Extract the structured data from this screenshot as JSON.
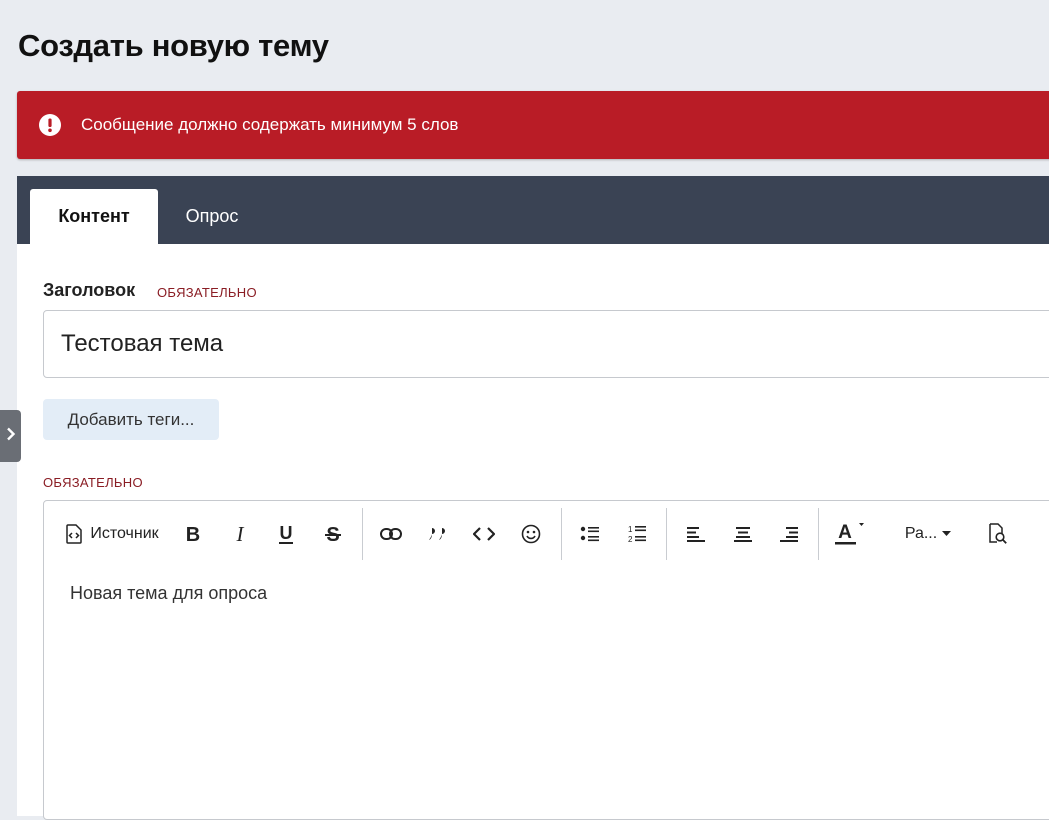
{
  "page": {
    "title": "Создать новую тему"
  },
  "alert": {
    "message": "Сообщение должно содержать минимум 5 слов",
    "icon": "exclamation-circle-icon",
    "color": "#b91c26"
  },
  "tabs": [
    {
      "label": "Контент",
      "active": true
    },
    {
      "label": "Опрос",
      "active": false
    }
  ],
  "form": {
    "title_label": "Заголовок",
    "required_label": "ОБЯЗАТЕЛЬНО",
    "title_value": "Тестовая тема",
    "tags_button": "Добавить теги...",
    "body_required_label": "ОБЯЗАТЕЛЬНО"
  },
  "editor": {
    "toolbar": {
      "source_label": "Источник",
      "paragraph_label": "Ра...",
      "buttons": [
        "source-icon",
        "bold-icon",
        "italic-icon",
        "underline-icon",
        "strikethrough-icon",
        "link-icon",
        "quote-icon",
        "code-icon",
        "emoji-icon",
        "bullet-list-icon",
        "numbered-list-icon",
        "align-left-icon",
        "align-center-icon",
        "align-right-icon",
        "text-color-icon",
        "paragraph-format-dropdown",
        "preview-icon"
      ]
    },
    "content": "Новая тема для опроса"
  },
  "colors": {
    "background": "#e9ecf1",
    "tabbar": "#3a4354",
    "required": "#8a1d24",
    "tags_button_bg": "#e3edf7"
  }
}
